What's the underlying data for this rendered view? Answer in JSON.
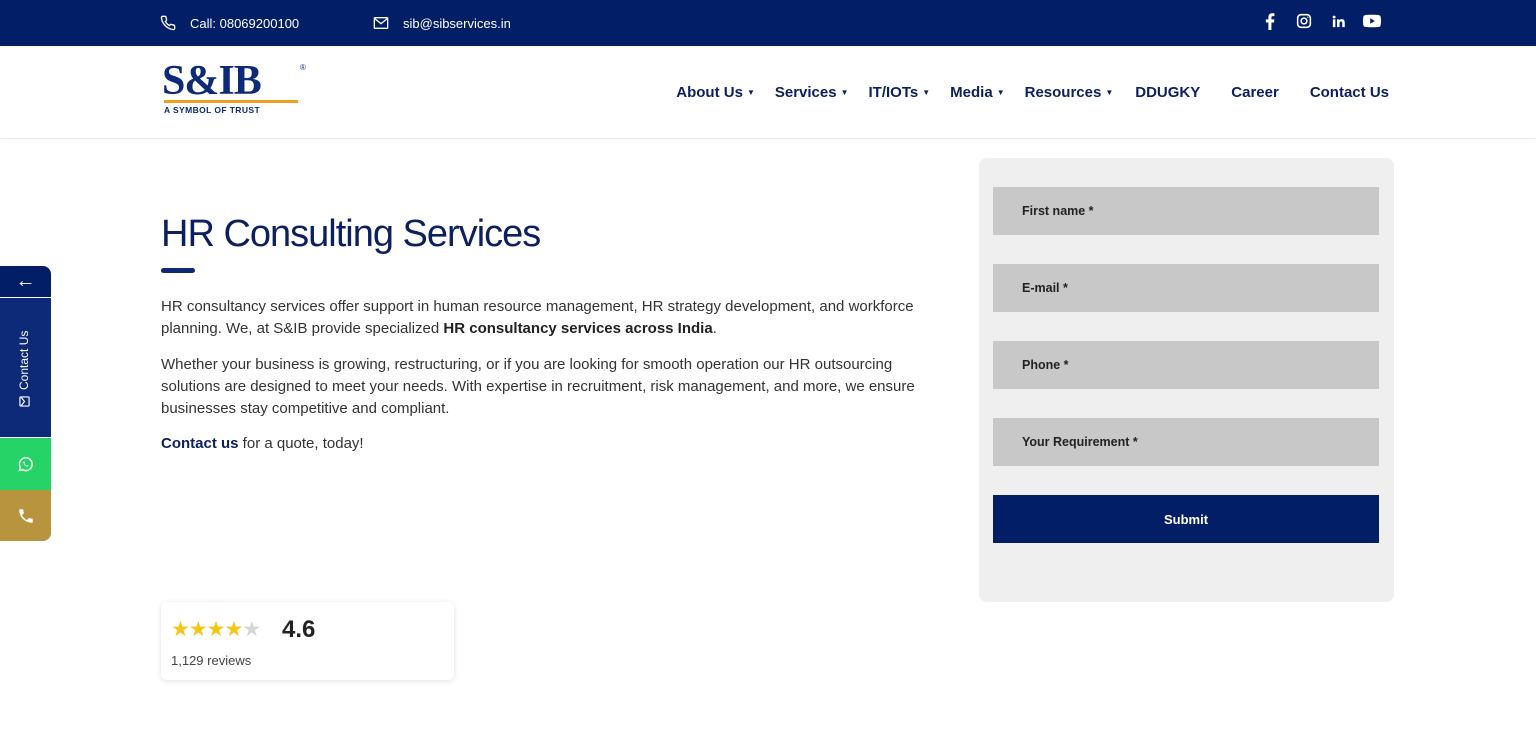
{
  "topbar": {
    "phone_label": "Call: 08069200100",
    "email_label": "sib@sibservices.in",
    "social": [
      "facebook-icon",
      "instagram-icon",
      "linkedin-icon",
      "youtube-icon"
    ]
  },
  "header": {
    "logo_mark": "S&IB",
    "logo_tagline": "A SYMBOL OF TRUST",
    "nav": [
      {
        "label": "About Us",
        "dropdown": true
      },
      {
        "label": "Services",
        "dropdown": true
      },
      {
        "label": "IT/IOTs",
        "dropdown": true
      },
      {
        "label": "Media",
        "dropdown": true
      },
      {
        "label": "Resources",
        "dropdown": true
      },
      {
        "label": "DDUGKY",
        "dropdown": false
      },
      {
        "label": "Career",
        "dropdown": false
      },
      {
        "label": "Contact Us",
        "dropdown": false
      }
    ]
  },
  "main": {
    "title": "HR Consulting Services",
    "p1_text": "HR consultancy services offer support in human resource management, HR strategy development, and workforce planning. We, at S&IB provide specialized ",
    "p1_bold": "HR consultancy services across India",
    "p1_end": ".",
    "p2": "Whether your business is growing, restructuring, or if you are looking for smooth operation our HR outsourcing solutions are designed to meet your needs. With expertise in recruitment, risk management, and more, we ensure businesses stay competitive and compliant.",
    "p3_link": "Contact us",
    "p3_rest": " for a quote, today!"
  },
  "form": {
    "first_name": "First name *",
    "email": "E-mail *",
    "phone": "Phone *",
    "requirement": "Your Requirement *",
    "submit": "Submit"
  },
  "review": {
    "rating": 4.6,
    "score_label": "4.6",
    "count_label": "1,129 reviews",
    "stars_filled": 4,
    "stars_total": 5
  },
  "side": {
    "arrow": "←",
    "contact_label": "Contact Us"
  },
  "colors": {
    "primary": "#021e66",
    "whatsapp": "#25d366",
    "call": "#b8943e",
    "star": "#f5c518"
  }
}
